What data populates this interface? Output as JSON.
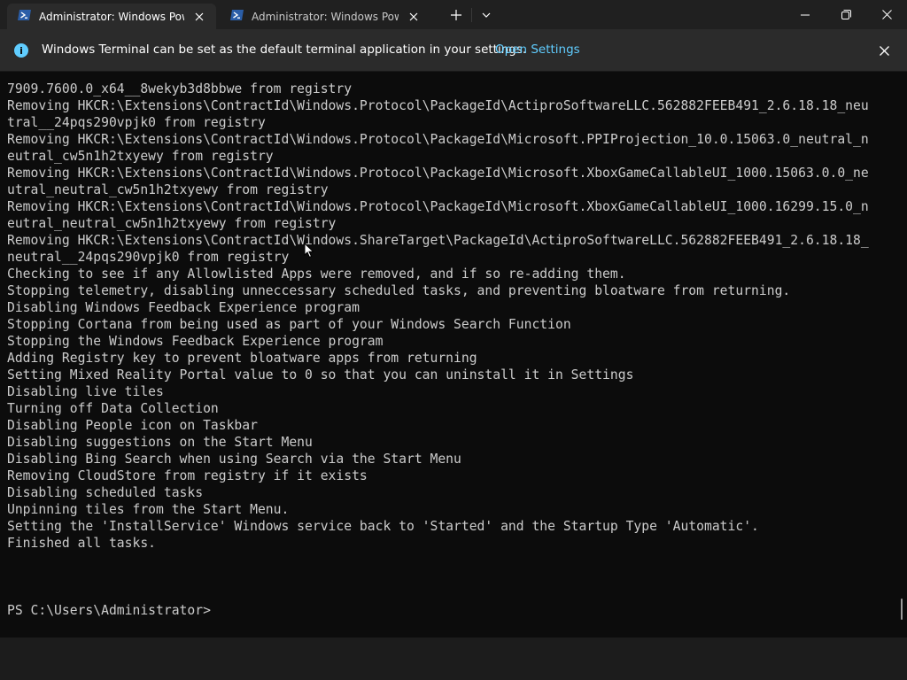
{
  "tabs": [
    {
      "title": "Administrator: Windows PowerShell",
      "icon": "powershell-icon",
      "active": true
    },
    {
      "title": "Administrator: Windows PowerShell",
      "icon": "powershell-icon",
      "active": false
    }
  ],
  "icons": {
    "new_tab": "plus-icon",
    "dropdown": "chevron-down-icon",
    "minimize": "minimize-icon",
    "maximize": "maximize-icon",
    "close": "close-icon",
    "info": "info-icon"
  },
  "colors": {
    "accent": "#60cdff",
    "terminal_bg": "#0c0c0c",
    "terminal_fg": "#cccccc",
    "titlebar_bg": "#202020"
  },
  "infobar": {
    "message": "Windows Terminal can be set as the default terminal application in your settings.",
    "link": "Open Settings",
    "info_glyph": "i"
  },
  "terminal": {
    "lines": [
      "7909.7600.0_x64__8wekyb3d8bbwe from registry",
      "Removing HKCR:\\Extensions\\ContractId\\Windows.Protocol\\PackageId\\ActiproSoftwareLLC.562882FEEB491_2.6.18.18_neu",
      "tral__24pqs290vpjk0 from registry",
      "Removing HKCR:\\Extensions\\ContractId\\Windows.Protocol\\PackageId\\Microsoft.PPIProjection_10.0.15063.0_neutral_n",
      "eutral_cw5n1h2txyewy from registry",
      "Removing HKCR:\\Extensions\\ContractId\\Windows.Protocol\\PackageId\\Microsoft.XboxGameCallableUI_1000.15063.0.0_ne",
      "utral_neutral_cw5n1h2txyewy from registry",
      "Removing HKCR:\\Extensions\\ContractId\\Windows.Protocol\\PackageId\\Microsoft.XboxGameCallableUI_1000.16299.15.0_n",
      "eutral_neutral_cw5n1h2txyewy from registry",
      "Removing HKCR:\\Extensions\\ContractId\\Windows.ShareTarget\\PackageId\\ActiproSoftwareLLC.562882FEEB491_2.6.18.18_",
      "neutral__24pqs290vpjk0 from registry",
      "Checking to see if any Allowlisted Apps were removed, and if so re-adding them.",
      "Stopping telemetry, disabling unneccessary scheduled tasks, and preventing bloatware from returning.",
      "Disabling Windows Feedback Experience program",
      "Stopping Cortana from being used as part of your Windows Search Function",
      "Stopping the Windows Feedback Experience program",
      "Adding Registry key to prevent bloatware apps from returning",
      "Setting Mixed Reality Portal value to 0 so that you can uninstall it in Settings",
      "Disabling live tiles",
      "Turning off Data Collection",
      "Disabling People icon on Taskbar",
      "Disabling suggestions on the Start Menu",
      "Disabling Bing Search when using Search via the Start Menu",
      "Removing CloudStore from registry if it exists",
      "Disabling scheduled tasks",
      "Unpinning tiles from the Start Menu.",
      "Setting the 'InstallService' Windows service back to 'Started' and the Startup Type 'Automatic'.",
      "Finished all tasks.",
      "",
      "",
      "",
      "PS C:\\Users\\Administrator>"
    ]
  }
}
